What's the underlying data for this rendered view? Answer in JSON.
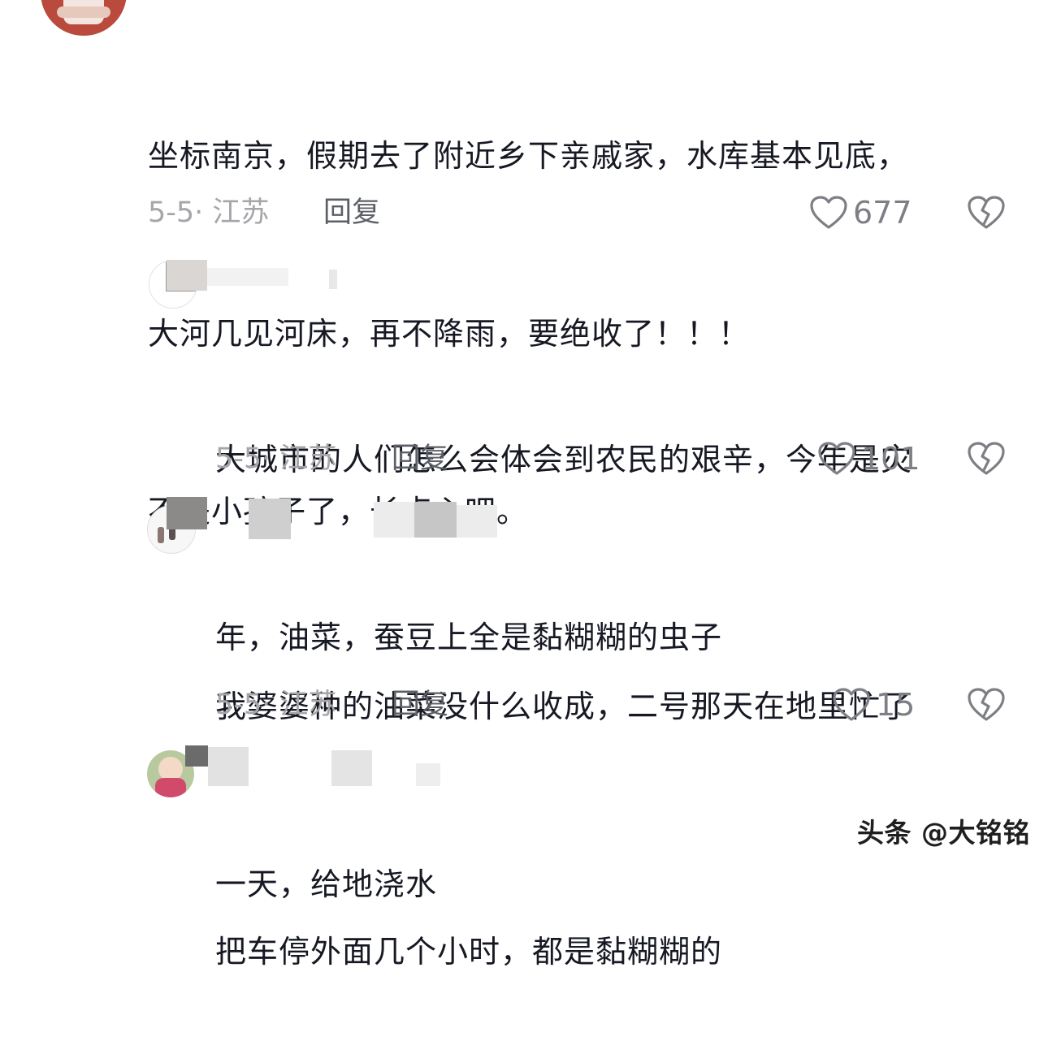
{
  "comments": [
    {
      "lines": [
        "坐标南京，假期去了附近乡下亲戚家，水库基本见底，",
        "大河几见河床，再不降雨，要绝收了！！！",
        "不是小孩子了，长点心吧。"
      ],
      "date_location": "5-5· 江苏",
      "reply_label": "回复",
      "likes": "677"
    },
    {
      "lines": [
        "大城市的人们怎么会体会到农民的艰辛，今年是灾",
        "年，油菜，蚕豆上全是黏糊糊的虫子"
      ],
      "date_location": "5-5· 江苏",
      "reply_label": "回复",
      "likes": "101"
    },
    {
      "lines": [
        "我婆婆种的油菜没什么收成，二号那天在地里忙了",
        "一天，给地浇水"
      ],
      "date_location": "5-5· 江苏",
      "reply_label": "回复",
      "likes": "15"
    },
    {
      "lines": [
        "把车停外面几个小时，都是黏糊糊的"
      ]
    }
  ],
  "icons": {
    "like": "heart-outline-icon",
    "dislike": "broken-heart-icon"
  },
  "watermark": "头条 @大铭铭",
  "colors": {
    "text": "#161823",
    "meta": "#a6a6aa",
    "reply": "#5c5f66",
    "icon": "#7e7f85"
  }
}
